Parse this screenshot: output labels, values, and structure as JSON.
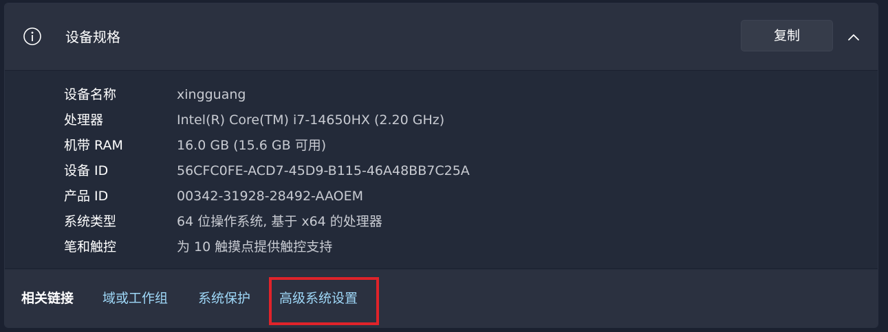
{
  "header": {
    "title": "设备规格",
    "copy_label": "复制",
    "info_icon": "info-icon",
    "collapse_icon": "chevron-up-icon"
  },
  "specs": [
    {
      "label": "设备名称",
      "value": "xingguang"
    },
    {
      "label": "处理器",
      "value": "Intel(R) Core(TM) i7-14650HX (2.20 GHz)"
    },
    {
      "label": "机带 RAM",
      "value": "16.0 GB (15.6 GB 可用)"
    },
    {
      "label": "设备 ID",
      "value": "56CFC0FE-ACD7-45D9-B115-46A48BB7C25A"
    },
    {
      "label": "产品 ID",
      "value": "00342-31928-28492-AAOEM"
    },
    {
      "label": "系统类型",
      "value": "64 位操作系统, 基于 x64 的处理器"
    },
    {
      "label": "笔和触控",
      "value": "为 10 触摸点提供触控支持"
    }
  ],
  "related_links": {
    "title": "相关链接",
    "items": [
      {
        "label": "域或工作组"
      },
      {
        "label": "系统保护"
      },
      {
        "label": "高级系统设置"
      }
    ]
  },
  "colors": {
    "link": "#9fd8f8",
    "highlight": "#e0232a",
    "background": "#232a39"
  }
}
